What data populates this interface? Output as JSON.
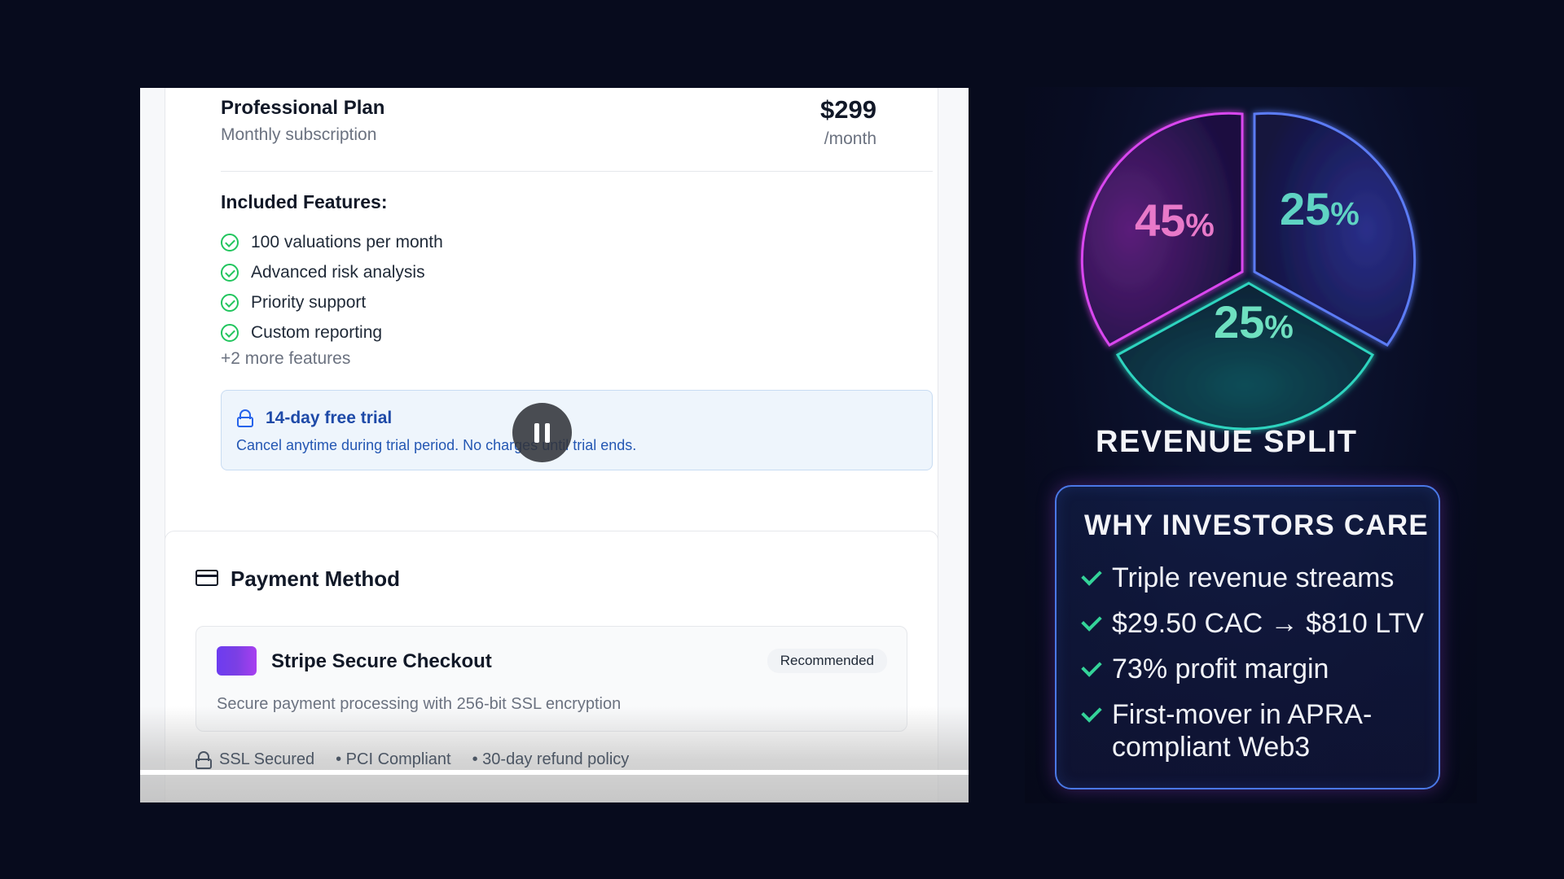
{
  "plan": {
    "name": "Professional Plan",
    "subtitle": "Monthly subscription",
    "price": "$299",
    "period": "/month"
  },
  "features": {
    "title": "Included Features:",
    "items": [
      "100 valuations per month",
      "Advanced risk analysis",
      "Priority support",
      "Custom reporting"
    ],
    "more": "+2 more features"
  },
  "trial": {
    "title": "14-day free trial",
    "description": "Cancel anytime during trial period. No charges until trial ends."
  },
  "payment": {
    "title": "Payment Method",
    "stripe_title": "Stripe Secure Checkout",
    "badge": "Recommended",
    "stripe_description": "Secure payment processing with 256-bit SSL encryption"
  },
  "footer": {
    "ssl": "SSL Secured",
    "pci": "• PCI Compliant",
    "refund": "• 30-day refund policy"
  },
  "infographic": {
    "title": "REVENUE SPLIT",
    "pie": [
      {
        "value": "45",
        "unit": "%",
        "color": "#d946ef"
      },
      {
        "value": "25",
        "unit": "%",
        "color": "#4f6cf0"
      },
      {
        "value": "25",
        "unit": "%",
        "color": "#2dd4bf"
      }
    ],
    "why_title": "WHY INVESTORS CARE",
    "why_items": [
      "Triple revenue streams",
      "$29.50 CAC → $810 LTV",
      "73% profit margin",
      "First-mover in APRA-compliant Web3"
    ]
  },
  "colors": {
    "page_bg": "#070b1d",
    "accent_green": "#22c55e",
    "trial_blue": "#1e4aa8",
    "check_teal": "#34d399"
  },
  "icons": {
    "check": "check-circle-icon",
    "lock": "lock-icon",
    "card": "credit-card-icon",
    "pause": "pause-icon"
  }
}
